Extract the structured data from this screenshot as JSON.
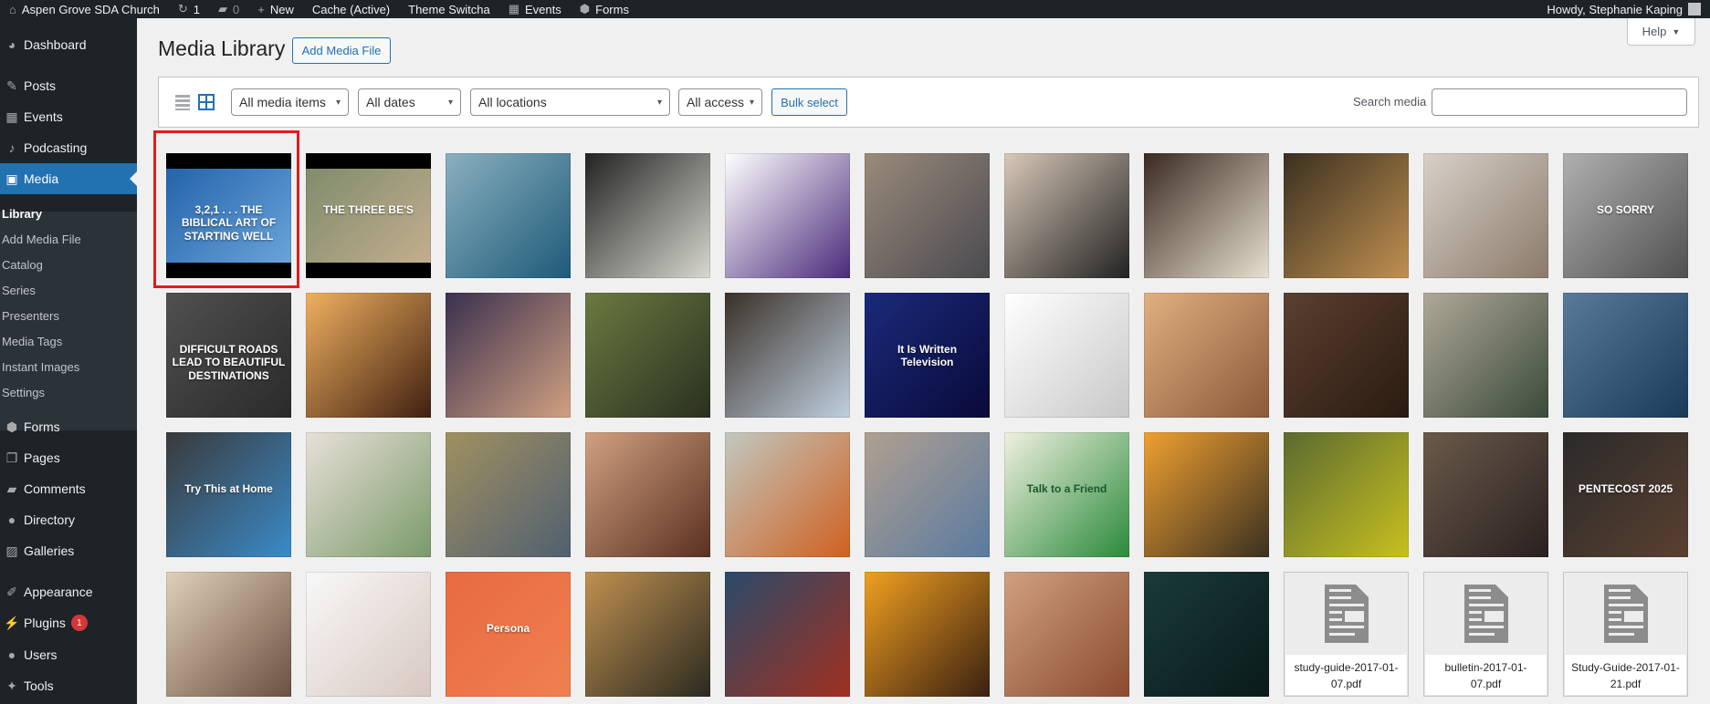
{
  "adminbar": {
    "site": "Aspen Grove SDA Church",
    "updates": "1",
    "comments": "0",
    "new": "New",
    "cache": "Cache (Active)",
    "theme": "Theme Switcha",
    "events": "Events",
    "forms": "Forms",
    "howdy": "Howdy, Stephanie Kaping"
  },
  "sidebar": {
    "items": [
      {
        "label": "Dashboard",
        "icon": "dashboard-icon",
        "glyph": "◕"
      },
      {
        "label": "Posts",
        "icon": "pin-icon",
        "glyph": "✎"
      },
      {
        "label": "Events",
        "icon": "calendar-icon",
        "glyph": "▦"
      },
      {
        "label": "Podcasting",
        "icon": "microphone-icon",
        "glyph": "♪"
      },
      {
        "label": "Media",
        "icon": "media-icon",
        "glyph": "▣"
      },
      {
        "label": "Forms",
        "icon": "forms-icon",
        "glyph": "⬢"
      },
      {
        "label": "Pages",
        "icon": "pages-icon",
        "glyph": "❐"
      },
      {
        "label": "Comments",
        "icon": "comment-icon",
        "glyph": "▰"
      },
      {
        "label": "Directory",
        "icon": "user-icon",
        "glyph": "●"
      },
      {
        "label": "Galleries",
        "icon": "gallery-icon",
        "glyph": "▨"
      },
      {
        "label": "Appearance",
        "icon": "brush-icon",
        "glyph": "✐"
      },
      {
        "label": "Plugins",
        "icon": "plugin-icon",
        "glyph": "⚡",
        "badge": "1"
      },
      {
        "label": "Users",
        "icon": "users-icon",
        "glyph": "●"
      },
      {
        "label": "Tools",
        "icon": "wrench-icon",
        "glyph": "✦"
      }
    ],
    "submenu": [
      "Library",
      "Add Media File",
      "Catalog",
      "Series",
      "Presenters",
      "Media Tags",
      "Instant Images",
      "Settings"
    ]
  },
  "page": {
    "title": "Media Library",
    "add_button": "Add Media File",
    "help": "Help"
  },
  "toolbar": {
    "filters": [
      "All media items",
      "All dates",
      "All locations",
      "All access"
    ],
    "bulk": "Bulk select",
    "search_label": "Search media",
    "search_value": ""
  },
  "media": [
    {
      "color": "#1f5fa8",
      "color2": "#6fa8dc",
      "caption": "3,2,1 . . . THE BIBLICAL ART OF STARTING WELL",
      "letterbox": true
    },
    {
      "color": "#7a8a6a",
      "color2": "#c8b090",
      "caption": "THE THREE BE'S",
      "letterbox": true
    },
    {
      "color": "#8ab0c0",
      "color2": "#1e5a78"
    },
    {
      "color": "#222222",
      "color2": "#d8d8d0"
    },
    {
      "color": "#ffffff",
      "color2": "#4a2a7a"
    },
    {
      "color": "#9a8a7a",
      "color2": "#4a4a50"
    },
    {
      "color": "#d8c8b8",
      "color2": "#222222"
    },
    {
      "color": "#3a2a20",
      "color2": "#e8e0d0"
    },
    {
      "color": "#3a3020",
      "color2": "#c09050"
    },
    {
      "color": "#d8d0c8",
      "color2": "#8a7a6a"
    },
    {
      "color": "#b0b0b0",
      "color2": "#505050",
      "caption": "SO SORRY"
    },
    {
      "color": "#505050",
      "color2": "#2a2a2a",
      "caption": "DIFFICULT ROADS LEAD TO BEAUTIFUL DESTINATIONS"
    },
    {
      "color": "#f0b060",
      "color2": "#402010"
    },
    {
      "color": "#3a3050",
      "color2": "#d0a080"
    },
    {
      "color": "#6a7a40",
      "color2": "#2a3020"
    },
    {
      "color": "#3a3028",
      "color2": "#c0d0e0"
    },
    {
      "color": "#1a2a7a",
      "color2": "#0a0a3a",
      "caption": "It Is Written Television"
    },
    {
      "color": "#ffffff",
      "color2": "#c8c8c8"
    },
    {
      "color": "#e0b080",
      "color2": "#8a5a3a"
    },
    {
      "color": "#5a4030",
      "color2": "#2a1a10"
    },
    {
      "color": "#b0a898",
      "color2": "#3a4a3a"
    },
    {
      "color": "#5a7a9a",
      "color2": "#1a3a5a"
    },
    {
      "color": "#3a3a3a",
      "color2": "#3a8ac8",
      "caption": "Try This at Home"
    },
    {
      "color": "#e8e0d8",
      "color2": "#7a9a6a"
    },
    {
      "color": "#a09060",
      "color2": "#506070"
    },
    {
      "color": "#d0a080",
      "color2": "#5a3020"
    },
    {
      "color": "#c0c8c0",
      "color2": "#d06020"
    },
    {
      "color": "#b0a090",
      "color2": "#5a7aa0"
    },
    {
      "color": "#f0f0e0",
      "color2": "#2a8a3a",
      "caption": "Talk to a Friend",
      "dark": true
    },
    {
      "color": "#f0a030",
      "color2": "#3a3020"
    },
    {
      "color": "#5a6a30",
      "color2": "#c8c020"
    },
    {
      "color": "#6a5a4a",
      "color2": "#2a2020"
    },
    {
      "color": "#2a2a2a",
      "color2": "#5a4030",
      "caption": "PENTECOST 2025"
    },
    {
      "color": "#e0d0b8",
      "color2": "#6a5040"
    },
    {
      "color": "#f8f8f8",
      "color2": "#d8c8c0"
    },
    {
      "color": "#e86a40",
      "color2": "#f08050",
      "caption": "Persona"
    },
    {
      "color": "#c09050",
      "color2": "#2a2a20"
    },
    {
      "color": "#2a4a6a",
      "color2": "#a03020"
    },
    {
      "color": "#f0a020",
      "color2": "#3a2010"
    },
    {
      "color": "#d0a080",
      "color2": "#8a4a30"
    },
    {
      "color": "#1a3a3a",
      "color2": "#0a1a1a"
    },
    {
      "filename": "study-guide-2017-01-07.pdf"
    },
    {
      "filename": "bulletin-2017-01-07.pdf"
    },
    {
      "filename": "Study-Guide-2017-01-21.pdf"
    }
  ]
}
